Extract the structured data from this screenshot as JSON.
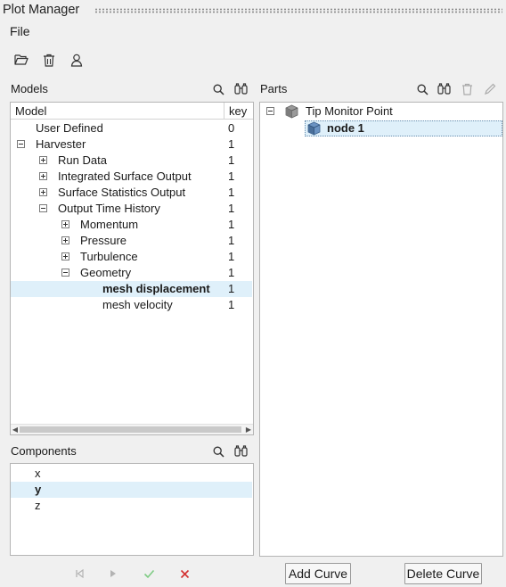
{
  "window": {
    "title": "Plot Manager"
  },
  "menu": {
    "file": "File"
  },
  "toolbar": {
    "icons": [
      "folder-open-icon",
      "trash-icon",
      "user-icon"
    ]
  },
  "models": {
    "label": "Models",
    "columns": {
      "model": "Model",
      "key": "key"
    },
    "rows": [
      {
        "label": "User Defined",
        "key": "0",
        "expander": "none"
      },
      {
        "label": "Harvester",
        "key": "1",
        "expander": "minus"
      },
      {
        "label": "Run Data",
        "key": "1",
        "expander": "plus"
      },
      {
        "label": "Integrated Surface Output",
        "key": "1",
        "expander": "plus"
      },
      {
        "label": "Surface Statistics Output",
        "key": "1",
        "expander": "plus"
      },
      {
        "label": "Output Time History",
        "key": "1",
        "expander": "minus"
      },
      {
        "label": "Momentum",
        "key": "1",
        "expander": "plus"
      },
      {
        "label": "Pressure",
        "key": "1",
        "expander": "plus"
      },
      {
        "label": "Turbulence",
        "key": "1",
        "expander": "plus"
      },
      {
        "label": "Geometry",
        "key": "1",
        "expander": "minus"
      },
      {
        "label": "mesh displacement",
        "key": "1",
        "expander": "none",
        "selected": true
      },
      {
        "label": "mesh velocity",
        "key": "1",
        "expander": "none"
      }
    ]
  },
  "parts": {
    "label": "Parts",
    "tree": [
      {
        "label": "Tip Monitor Point",
        "expander": "minus"
      },
      {
        "label": "node 1",
        "selected": true
      }
    ]
  },
  "components": {
    "label": "Components",
    "items": [
      {
        "label": "x"
      },
      {
        "label": "y",
        "selected": true
      },
      {
        "label": "z"
      }
    ]
  },
  "footer": {
    "add_curve": "Add Curve",
    "delete_curve": "Delete Curve"
  },
  "colors": {
    "selection": "#dff0fa",
    "accept": "#4caf50",
    "reject": "#d32f2f",
    "part_icon": "#4a6f9a"
  }
}
